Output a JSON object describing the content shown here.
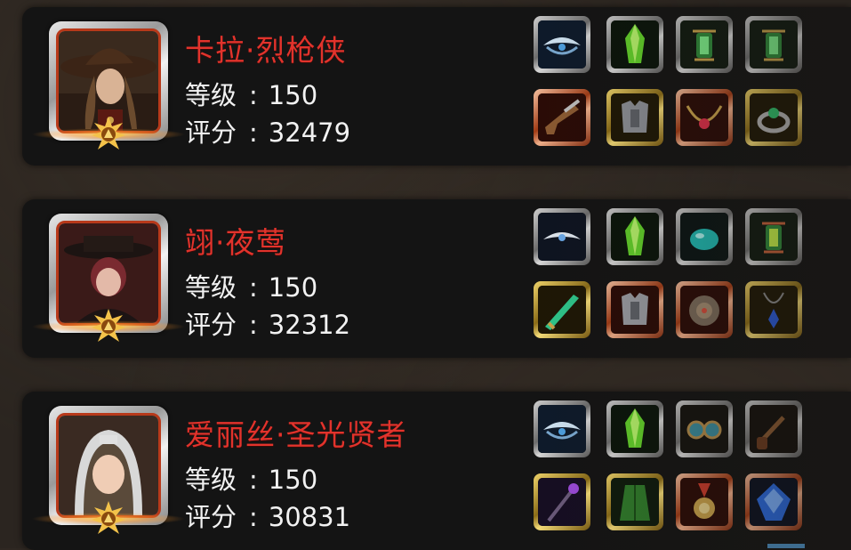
{
  "heroes": [
    {
      "name": "卡拉·烈枪侠",
      "level_label": "等级",
      "level_value": "150",
      "score_label": "评分",
      "score_value": "32479",
      "portrait": "gunslinger-hat-portrait",
      "items": [
        {
          "icon": "wing-headband-icon",
          "frame": "plain"
        },
        {
          "icon": "green-crystal-icon",
          "frame": "plain"
        },
        {
          "icon": "green-lantern-icon",
          "frame": "plain"
        },
        {
          "icon": "green-lantern-icon",
          "frame": "plain"
        },
        {
          "icon": "flintlock-pistol-icon",
          "frame": "red"
        },
        {
          "icon": "steel-armor-icon",
          "frame": "gold"
        },
        {
          "icon": "ruby-necklace-icon",
          "frame": "red"
        },
        {
          "icon": "emerald-ring-icon",
          "frame": "gold"
        }
      ]
    },
    {
      "name": "翊·夜莺",
      "level_label": "等级",
      "level_value": "150",
      "score_label": "评分",
      "score_value": "32312",
      "portrait": "nightingale-portrait",
      "items": [
        {
          "icon": "silver-headband-icon",
          "frame": "plain"
        },
        {
          "icon": "green-crystal-icon",
          "frame": "plain"
        },
        {
          "icon": "teal-gem-icon",
          "frame": "plain"
        },
        {
          "icon": "green-lantern-icon",
          "frame": "plain"
        },
        {
          "icon": "jade-dagger-icon",
          "frame": "gold"
        },
        {
          "icon": "steel-armor-icon",
          "frame": "red"
        },
        {
          "icon": "round-shield-icon",
          "frame": "red"
        },
        {
          "icon": "blue-pendant-icon",
          "frame": "gold"
        }
      ]
    },
    {
      "name": "爱丽丝·圣光贤者",
      "level_label": "等级",
      "level_value": "150",
      "score_label": "评分",
      "score_value": "30831",
      "portrait": "holy-sage-portrait",
      "items": [
        {
          "icon": "wing-headband-icon",
          "frame": "plain"
        },
        {
          "icon": "green-crystal-icon",
          "frame": "plain"
        },
        {
          "icon": "goggles-icon",
          "frame": "plain"
        },
        {
          "icon": "smoking-pipe-icon",
          "frame": "plain"
        },
        {
          "icon": "dark-staff-icon",
          "frame": "gold"
        },
        {
          "icon": "green-robe-icon",
          "frame": "gold"
        },
        {
          "icon": "medal-icon",
          "frame": "red"
        },
        {
          "icon": "blue-sapphire-icon",
          "frame": "red"
        }
      ]
    }
  ],
  "colors": {
    "name": "#e2332c",
    "stat": "#f2f2f2",
    "card_bg": "#141414",
    "page_bg": "#2b2520"
  }
}
